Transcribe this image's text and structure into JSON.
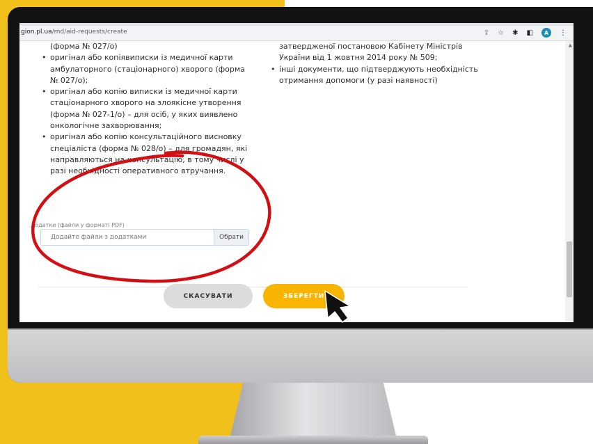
{
  "browser": {
    "url_prefix": "gion.pl.ua",
    "url_path": "/md/aid-requests/create",
    "avatar_letter": "A",
    "icons": [
      "share-icon",
      "star-icon",
      "extensions-icon",
      "sidepanel-icon",
      "menu-icon"
    ]
  },
  "left_list": {
    "items": [
      {
        "text": "(форма № 027/о)",
        "bullet": false
      },
      {
        "text": "оригінал або копіявиписки із медичної карти амбулаторного (стаціонарного) хворого (форма № 027/о);",
        "bullet": true
      },
      {
        "text": "оригінал або копію виписки із медичної карти стаціонарного хворого на злоякісне утворення (форма № 027-1/о) – для осіб, у яких виявлено онкологічне захворювання;",
        "bullet": true
      },
      {
        "text": "оригінал або копію консультаційного висновку спеціаліста (форма № 028/о) – для громадян, які направляються на консультацію, в тому числі у разі необхідності оперативного втручання.",
        "bullet": true
      }
    ]
  },
  "right_list": {
    "items": [
      {
        "text": "затвердженої постановою Кабінету Міністрів України від 1 жовтня 2014 року № 509;",
        "bullet": false
      },
      {
        "text": "інші документи, що підтверджують необхідність отримання допомоги (у разі наявності)",
        "bullet": true
      }
    ]
  },
  "attachments": {
    "label": "Додатки (файли у форматі PDF)",
    "placeholder": "Додайте файли з додатками",
    "browse_label": "Обрати"
  },
  "actions": {
    "cancel_label": "СКАСУВАТИ",
    "save_label": "ЗБЕРЕГТИ"
  },
  "colors": {
    "brand_yellow": "#f2c01b",
    "save_button": "#f7b500",
    "highlight_circle": "#d40f14"
  }
}
